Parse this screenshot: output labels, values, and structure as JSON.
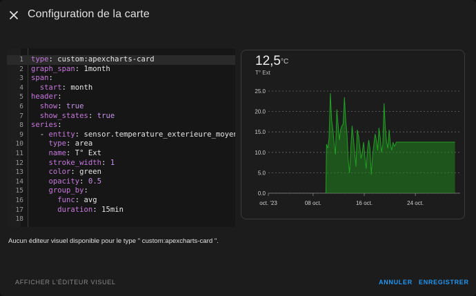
{
  "dialog": {
    "title": "Configuration de la carte"
  },
  "icons": {
    "close": "close-icon"
  },
  "editor": {
    "lines": [
      {
        "n": "1",
        "text": "type: custom:apexcharts-card"
      },
      {
        "n": "2",
        "text": "graph_span: 1month"
      },
      {
        "n": "3",
        "text": "span:"
      },
      {
        "n": "4",
        "text": "  start: month"
      },
      {
        "n": "5",
        "text": "header:"
      },
      {
        "n": "6",
        "text": "  show: true"
      },
      {
        "n": "7",
        "text": "  show_states: true"
      },
      {
        "n": "8",
        "text": "series:"
      },
      {
        "n": "9",
        "text": "  - entity: sensor.temperature_exterieure_moyenne"
      },
      {
        "n": "10",
        "text": "    type: area"
      },
      {
        "n": "11",
        "text": "    name: T° Ext"
      },
      {
        "n": "12",
        "text": "    stroke_width: 1"
      },
      {
        "n": "13",
        "text": "    color: green"
      },
      {
        "n": "14",
        "text": "    opacity: 0.5"
      },
      {
        "n": "15",
        "text": "    group_by:"
      },
      {
        "n": "16",
        "text": "      func: avg"
      },
      {
        "n": "17",
        "text": "      duration: 15min"
      },
      {
        "n": "18",
        "text": ""
      }
    ]
  },
  "preview": {
    "value": "12,5",
    "unit": "°C",
    "name": "T° Ext"
  },
  "chart_data": {
    "type": "area",
    "x_tick_labels": [
      "oct. '23",
      "08 oct.",
      "16 oct.",
      "24 oct."
    ],
    "x_ticks_day": [
      1,
      8,
      16,
      24
    ],
    "xlim_day": [
      1,
      31
    ],
    "y_tick_labels": [
      "0.0",
      "5.0",
      "10.0",
      "15.0",
      "20.0",
      "25.0"
    ],
    "ylim": [
      0,
      25
    ],
    "grid": true,
    "color": "#1e8e1e",
    "series": [
      {
        "x_day": [
          10.0,
          10.1,
          10.3,
          10.5,
          10.7,
          10.9,
          11.1,
          11.3,
          11.5,
          11.7,
          11.9,
          12.1,
          12.3,
          12.5,
          12.7,
          12.9,
          13.1,
          13.3,
          13.5,
          13.7,
          13.9,
          14.1,
          14.3,
          14.5,
          14.7,
          14.9,
          15.1,
          15.3,
          15.5,
          15.7,
          15.9,
          16.1,
          16.3,
          16.5,
          16.7,
          16.9,
          17.1,
          17.3,
          17.5,
          17.7,
          17.9,
          18.1,
          18.3,
          18.5,
          18.7,
          18.9,
          19.1,
          19.3,
          19.5,
          19.7,
          19.9,
          20.1,
          20.3,
          20.5,
          20.7,
          20.9,
          21.0,
          21.0,
          30.2
        ],
        "values": [
          0,
          12.0,
          11.0,
          13.5,
          24.5,
          18.0,
          15.5,
          12.0,
          9.5,
          20.5,
          17.0,
          13.0,
          15.5,
          16.5,
          17.0,
          23.5,
          18.0,
          14.5,
          8.0,
          5.0,
          11.0,
          16.5,
          13.5,
          10.0,
          6.5,
          15.5,
          14.0,
          11.5,
          8.5,
          10.0,
          12.5,
          9.0,
          6.0,
          10.5,
          13.0,
          11.0,
          4.5,
          9.0,
          12.0,
          14.5,
          13.0,
          10.5,
          16.0,
          13.5,
          10.0,
          12.0,
          22.0,
          16.0,
          12.5,
          11.0,
          15.5,
          12.0,
          10.5,
          12.5,
          11.5,
          12.0,
          12.5,
          12.5,
          12.5
        ]
      }
    ]
  },
  "message": {
    "text": "Aucun éditeur visuel disponible pour le type \" custom:apexcharts-card \"."
  },
  "footer": {
    "visual_editor": "AFFICHER L'ÉDITEUR VISUEL",
    "cancel": "ANNULER",
    "save": "ENREGISTRER"
  }
}
